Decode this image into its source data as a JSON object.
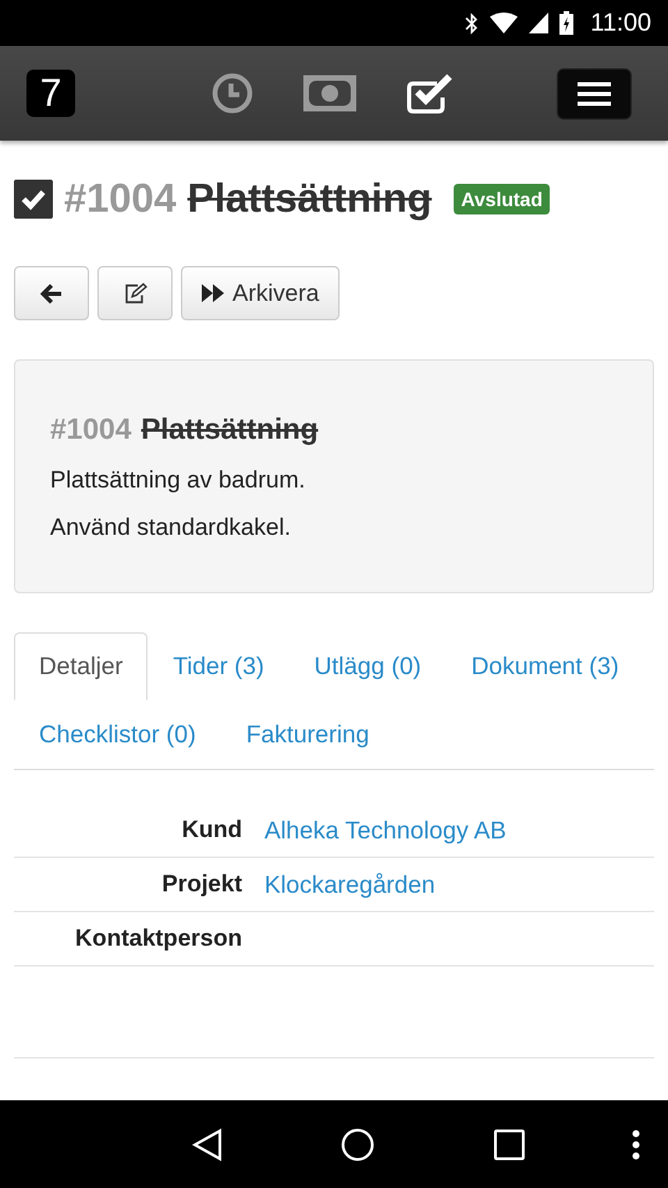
{
  "status_bar": {
    "time": "11:00"
  },
  "app_bar": {
    "logo": "7",
    "nav": [
      {
        "kind": "clock",
        "selected": false
      },
      {
        "kind": "money",
        "selected": false
      },
      {
        "kind": "check",
        "selected": true
      }
    ]
  },
  "task": {
    "checked": true,
    "number": "#1004",
    "title": "Plattsättning",
    "done": true,
    "badge": "Avslutad"
  },
  "actions": [
    {
      "kind": "back"
    },
    {
      "kind": "edit"
    },
    {
      "kind": "archive",
      "label": "Arkivera"
    }
  ],
  "panel": {
    "number": "#1004",
    "title": "Plattsättning",
    "done": true,
    "lines": [
      "Plattsättning av badrum.",
      "Använd standardkakel."
    ]
  },
  "tabs": [
    {
      "label": "Detaljer",
      "selected": true
    },
    {
      "label": "Tider (3)",
      "selected": false
    },
    {
      "label": "Utlägg (0)",
      "selected": false
    },
    {
      "label": "Dokument (3)",
      "selected": false
    },
    {
      "label": "Checklistor (0)",
      "selected": false
    },
    {
      "label": "Fakturering",
      "selected": false
    }
  ],
  "details": [
    {
      "label": "Kund",
      "value": "Alheka Technology AB"
    },
    {
      "label": "Projekt",
      "value": "Klockaregården"
    },
    {
      "label": "Kontaktperson"
    }
  ]
}
